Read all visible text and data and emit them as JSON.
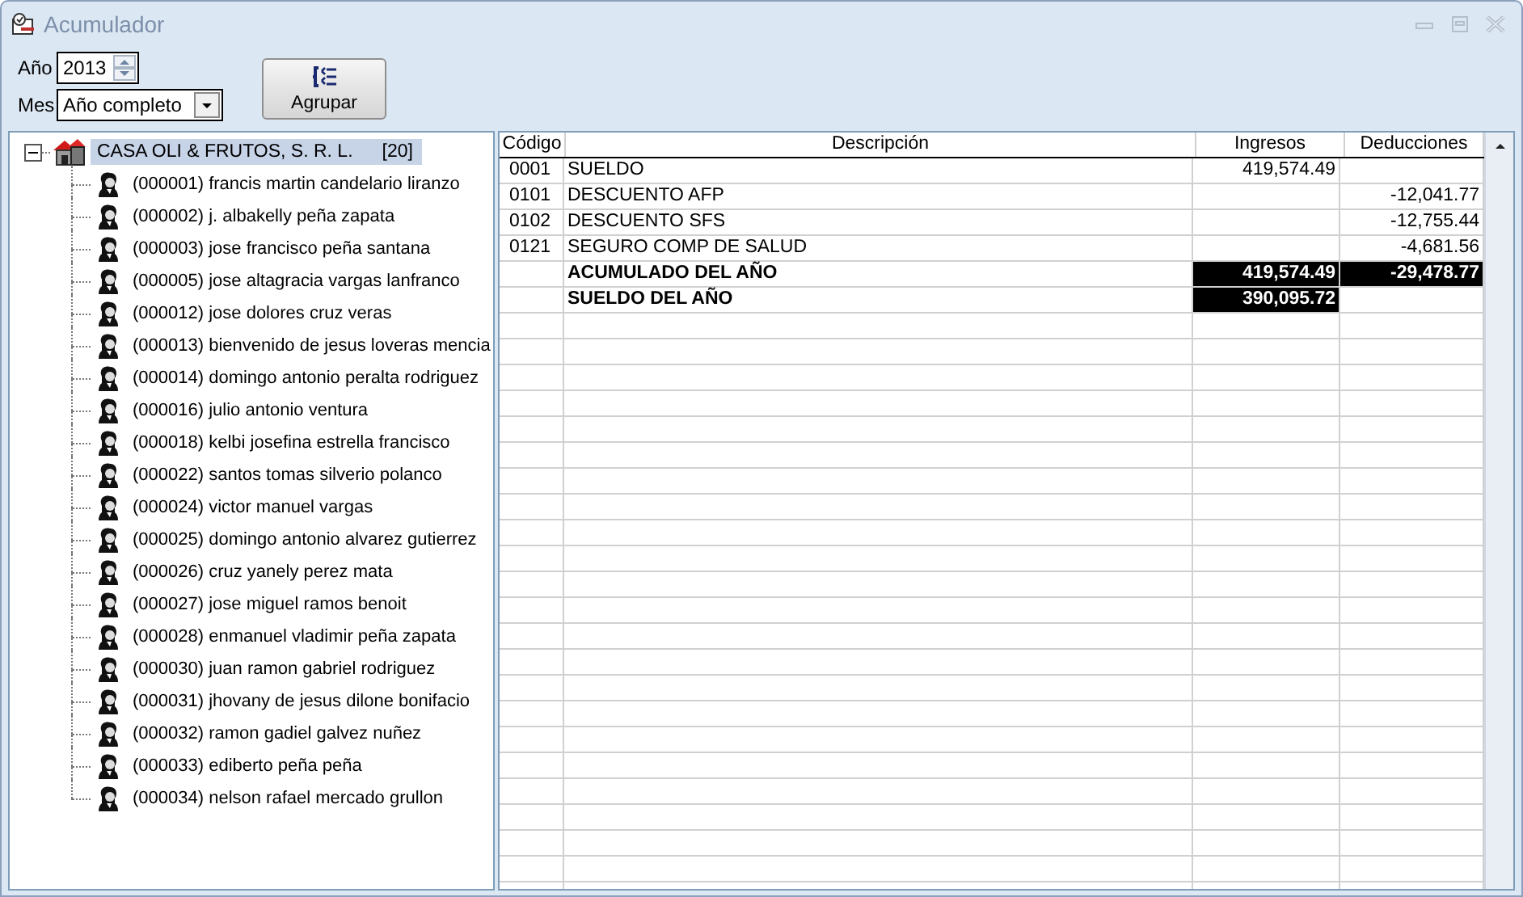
{
  "window": {
    "title": "Acumulador"
  },
  "filters": {
    "year_label": "Año",
    "year": "2013",
    "month_label": "Mes",
    "month": "Año completo"
  },
  "group_button": "Agrupar",
  "tree": {
    "label": "CASA OLI & FRUTOS, S. R. L.",
    "count": "[20]",
    "expanded": true,
    "selected": true,
    "children": [
      {
        "label": "(000001) francis martin candelario liranzo",
        "selected": false
      },
      {
        "label": "(000002) j. albakelly peña zapata",
        "selected": false
      },
      {
        "label": "(000003) jose francisco peña santana",
        "selected": false
      },
      {
        "label": "(000005) jose altagracia vargas lanfranco",
        "selected": false
      },
      {
        "label": "(000012) jose dolores cruz veras",
        "selected": false
      },
      {
        "label": "(000013) bienvenido de jesus loveras mencia",
        "selected": false
      },
      {
        "label": "(000014) domingo antonio peralta rodriguez",
        "selected": false
      },
      {
        "label": "(000016) julio antonio ventura",
        "selected": false
      },
      {
        "label": "(000018) kelbi josefina estrella francisco",
        "selected": false
      },
      {
        "label": "(000022) santos tomas silverio polanco",
        "selected": false
      },
      {
        "label": "(000024) victor manuel vargas",
        "selected": false
      },
      {
        "label": "(000025) domingo antonio alvarez gutierrez",
        "selected": false
      },
      {
        "label": "(000026) cruz yanely perez mata",
        "selected": false
      },
      {
        "label": "(000027) jose miguel ramos benoit",
        "selected": false
      },
      {
        "label": "(000028) enmanuel vladimir peña zapata",
        "selected": false
      },
      {
        "label": "(000030) juan ramon gabriel rodriguez",
        "selected": false
      },
      {
        "label": "(000031) jhovany de jesus dilone bonifacio",
        "selected": false
      },
      {
        "label": "(000032) ramon gadiel galvez nuñez",
        "selected": false
      },
      {
        "label": "(000033) ediberto peña peña",
        "selected": false
      },
      {
        "label": "(000034) nelson rafael mercado grullon",
        "selected": false
      }
    ]
  },
  "table": {
    "columns": [
      "Código",
      "Descripción",
      "Ingresos",
      "Deducciones"
    ],
    "rows": [
      {
        "kind": "detail",
        "codigo": "0001",
        "descripcion": "SUELDO",
        "ingresos": "419,574.49"
      },
      {
        "kind": "detail",
        "codigo": "0101",
        "descripcion": "DESCUENTO AFP",
        "deducciones": "-12,041.77"
      },
      {
        "kind": "detail",
        "codigo": "0102",
        "descripcion": "DESCUENTO SFS",
        "deducciones": "-12,755.44"
      },
      {
        "kind": "detail",
        "codigo": "0121",
        "descripcion": "SEGURO COMP DE SALUD",
        "deducciones": "-4,681.56"
      },
      {
        "kind": "total",
        "descripcion": "ACUMULADO DEL AÑO",
        "ingresos": "419,574.49",
        "deducciones": "-29,478.77"
      },
      {
        "kind": "total",
        "descripcion": "SUELDO DEL AÑO",
        "ingresos": "390,095.72"
      }
    ]
  }
}
